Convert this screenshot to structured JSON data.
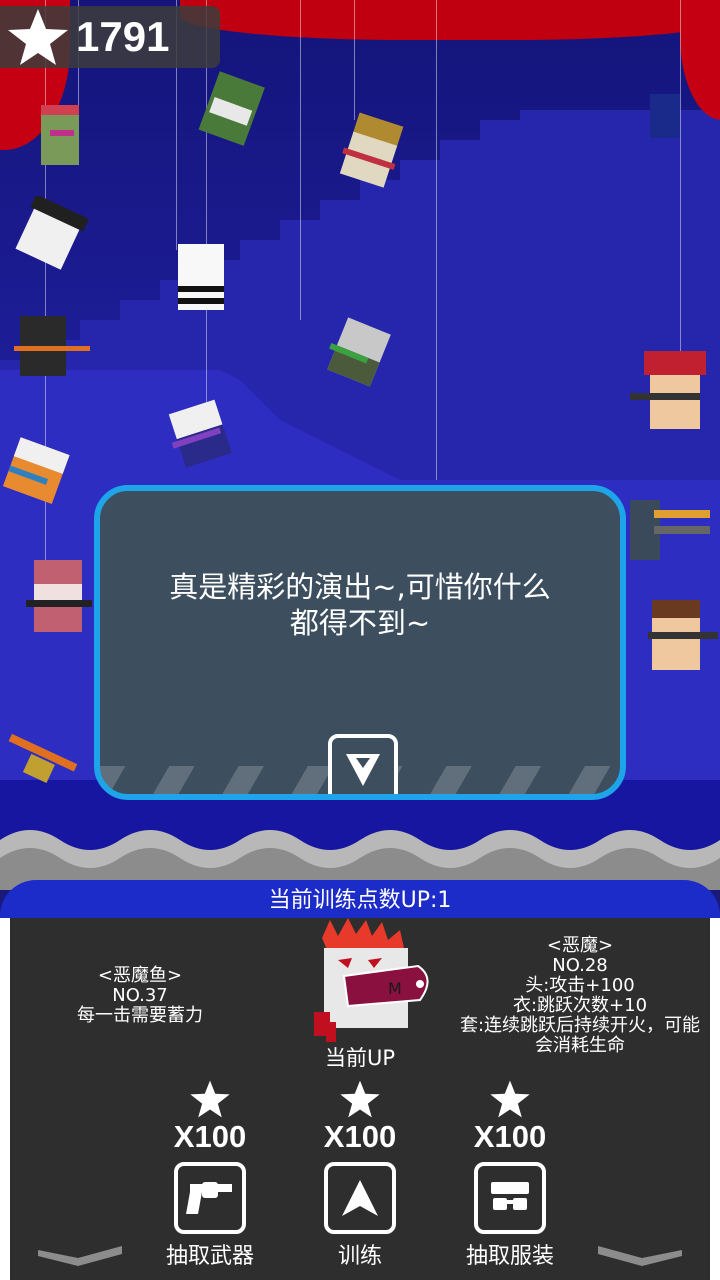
{
  "score": {
    "value": "1791",
    "icon": "star-icon"
  },
  "dialog": {
    "line1": "真是精彩的演出~,可惜你什么",
    "line2": "都得不到~"
  },
  "panel": {
    "title": "当前训练点数UP:1",
    "current_up_label": "当前UP",
    "left_info": {
      "name": "<恶魔鱼>",
      "number": "NO.37",
      "desc": "每一击需要蓄力"
    },
    "right_info": {
      "name": "<恶魔>",
      "number": "NO.28",
      "head": "头:攻击+100",
      "clothes": "衣:跳跃次数+10",
      "set1": "套:连续跳跃后持续开火，可能",
      "set2": "会消耗生命"
    },
    "actions": [
      {
        "cost": "X100",
        "label": "抽取武器",
        "icon": "revolver-icon"
      },
      {
        "cost": "X100",
        "label": "训练",
        "icon": "arrow-up-icon"
      },
      {
        "cost": "X100",
        "label": "抽取服装",
        "icon": "sunglasses-icon"
      }
    ]
  },
  "colors": {
    "curtain": "#c40012",
    "dialog_bg": "#3d4f5e",
    "dialog_border": "#1ea4e8",
    "panel_header": "#1c2cc8",
    "panel_bg": "#2e2e2e"
  }
}
